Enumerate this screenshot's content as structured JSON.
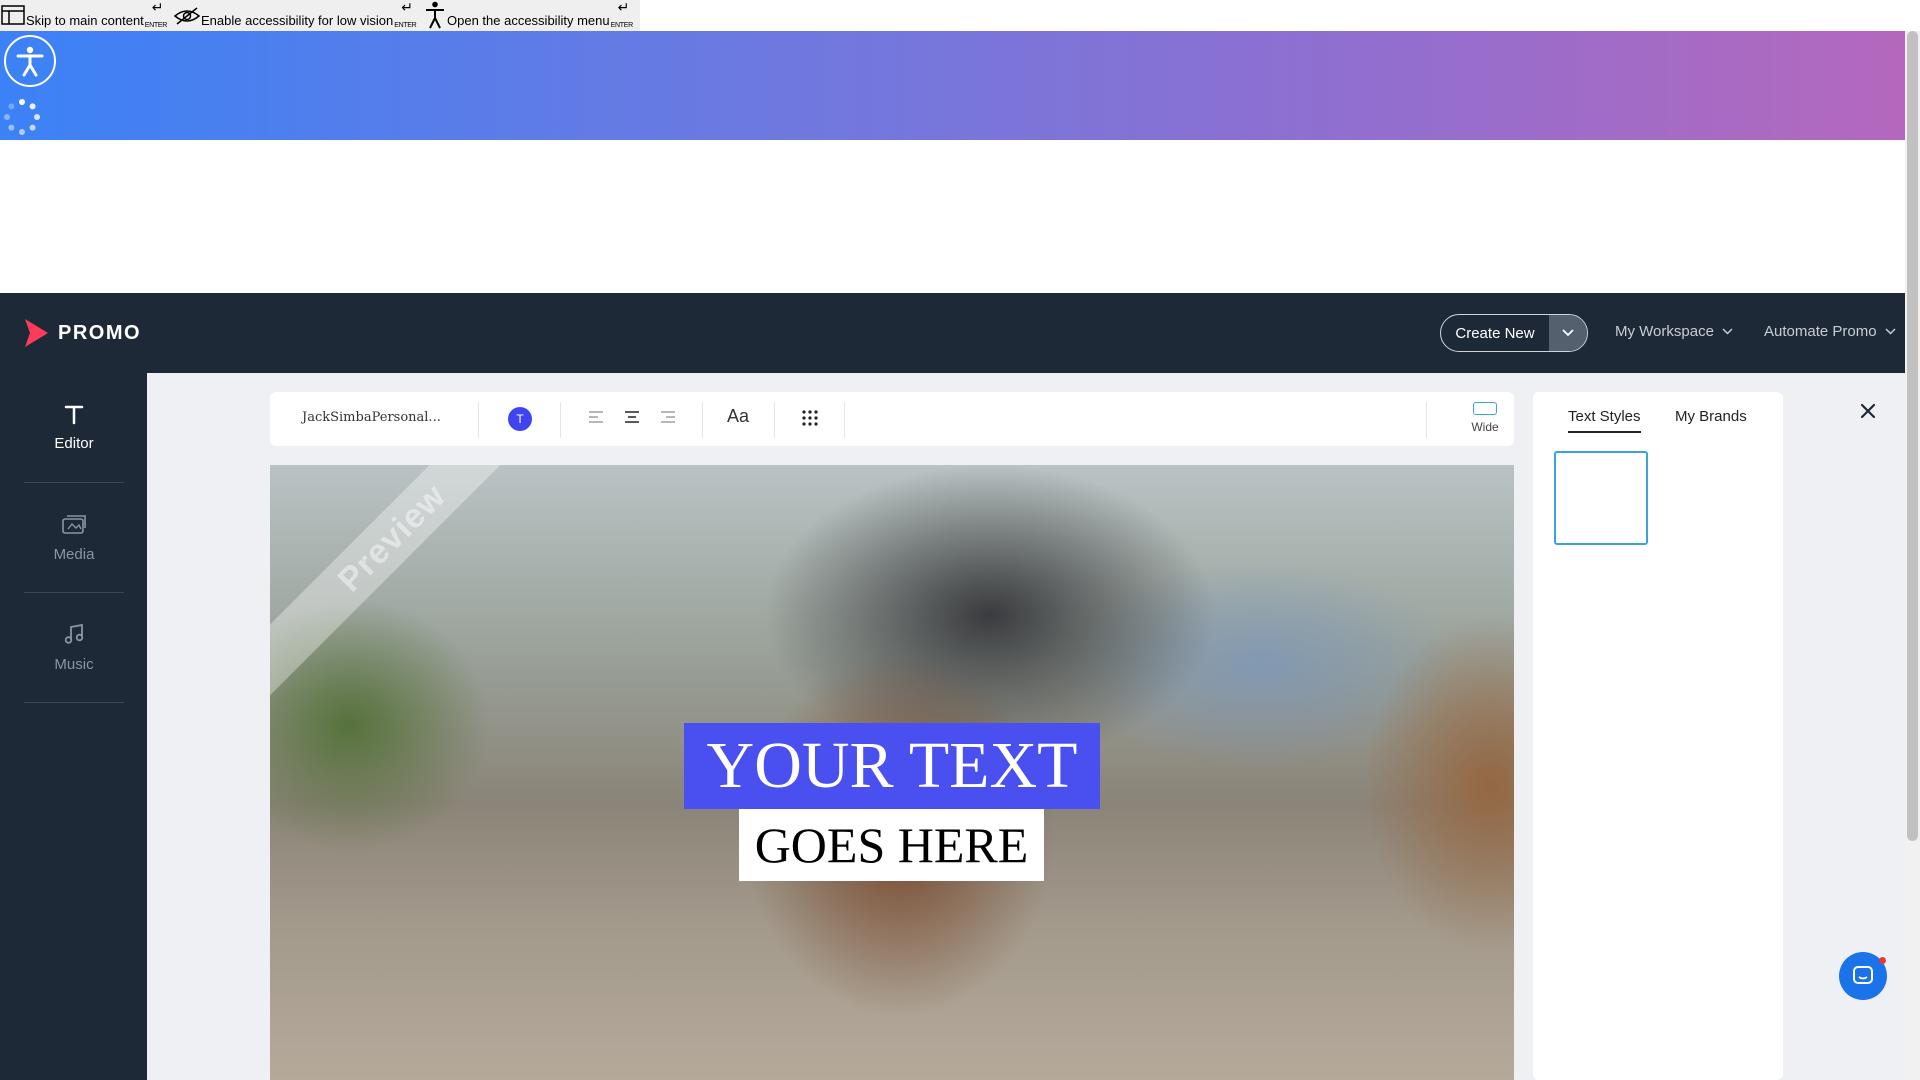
{
  "skip_links": [
    {
      "label": "Skip to main content",
      "key": "ENTER"
    },
    {
      "label": "Enable accessibility for low vision",
      "key": "ENTER"
    },
    {
      "label": "Open the accessibility menu",
      "key": "ENTER"
    }
  ],
  "brand": {
    "name": "PROMO"
  },
  "topnav": {
    "create_new": "Create New",
    "workspace": "My Workspace",
    "automate": "Automate Promo"
  },
  "sidebar": {
    "items": [
      {
        "label": "Editor",
        "icon": "text-t-icon",
        "active": true
      },
      {
        "label": "Media",
        "icon": "media-icon",
        "active": false
      },
      {
        "label": "Music",
        "icon": "music-note-icon",
        "active": false
      }
    ]
  },
  "toolbar": {
    "font": "JackSimbaPersonal...",
    "color_letter": "T",
    "font_size_label": "Aa",
    "wide_label": "Wide"
  },
  "canvas": {
    "watermark": "Preview",
    "line1": "YOUR TEXT",
    "line2": "GOES HERE"
  },
  "right_panel": {
    "tabs": [
      {
        "label": "Text Styles",
        "active": true
      },
      {
        "label": "My Brands",
        "active": false
      }
    ]
  },
  "colors": {
    "nav_bg": "#1e2937",
    "accent": "#4a4ff0",
    "selection": "#3aa3d9",
    "chat": "#1a73e8"
  }
}
